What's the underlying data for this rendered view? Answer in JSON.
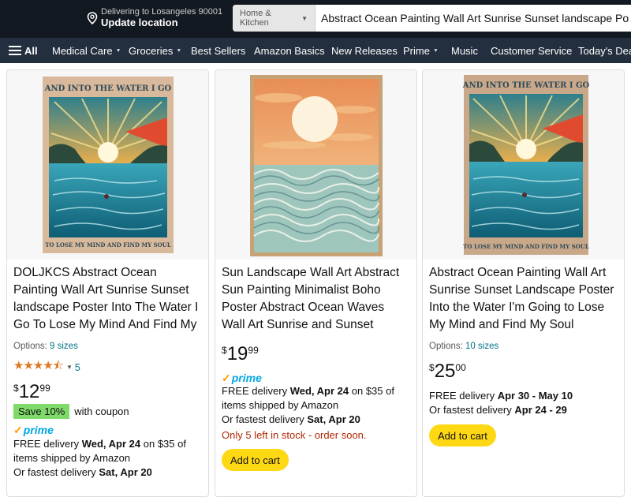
{
  "header": {
    "location_line1": "Delivering to Losangeles 90001",
    "location_line2": "Update location",
    "search_category": "Home & Kitchen",
    "search_value": "Abstract Ocean Painting Wall Art Sunrise Sunset landscape Poster"
  },
  "nav": {
    "all": "All",
    "items": [
      "Medical Care",
      "Groceries",
      "Best Sellers",
      "Amazon Basics",
      "New Releases",
      "Prime",
      "Music",
      "Customer Service",
      "Today's Deals"
    ]
  },
  "colors": {
    "accent": "#ffd814",
    "link": "#007185",
    "prime": "#00a8e1",
    "stock": "#b12704",
    "coupon": "#7fda69"
  },
  "products": [
    {
      "poster_top_text": "AND INTO THE WATER I GO",
      "poster_bottom_text": "TO LOSE MY MIND AND FIND MY SOUL",
      "title": "DOLJKCS Abstract Ocean Painting Wall Art Sunrise Sunset landscape Poster Into The Water I Go To Lose My Mind And Find My Soul Canvas…",
      "options_label": "Options:",
      "options_value": "9 sizes",
      "rating": 4.5,
      "rating_count": "5",
      "price_symbol": "$",
      "price_whole": "12",
      "price_fraction": "99",
      "coupon_badge": "Save 10%",
      "coupon_text": "with coupon",
      "prime_label": "prime",
      "delivery_prefix": "FREE delivery",
      "delivery_date": "Wed, Apr 24",
      "delivery_suffix": "on $35 of items shipped by Amazon",
      "fastest_prefix": "Or fastest delivery",
      "fastest_date": "Sat, Apr 20"
    },
    {
      "title": "Sun Landscape Wall Art Abstract Sun Painting Minimalist Boho Poster Abstract Ocean Waves Wall Art Sunrise and Sunset Pictures…",
      "price_symbol": "$",
      "price_whole": "19",
      "price_fraction": "99",
      "prime_label": "prime",
      "delivery_prefix": "FREE delivery",
      "delivery_date": "Wed, Apr 24",
      "delivery_suffix": "on $35 of items shipped by Amazon",
      "fastest_prefix": "Or fastest delivery",
      "fastest_date": "Sat, Apr 20",
      "stock_text": "Only 5 left in stock - order soon.",
      "button_label": "Add to cart"
    },
    {
      "poster_top_text": "AND INTO THE WATER I GO",
      "poster_bottom_text": "TO LOSE MY MIND AND FIND MY SOUL",
      "title": "Abstract Ocean Painting Wall Art Sunrise Sunset Landscape Poster Into the Water I'm Going to Lose My Mind and Find My Soul Canvas…",
      "options_label": "Options:",
      "options_value": "10 sizes",
      "price_symbol": "$",
      "price_whole": "25",
      "price_fraction": "00",
      "delivery_prefix": "FREE delivery",
      "delivery_date": "Apr 30 - May 10",
      "fastest_prefix": "Or fastest delivery",
      "fastest_date": "Apr 24 - 29",
      "button_label": "Add to cart"
    }
  ]
}
